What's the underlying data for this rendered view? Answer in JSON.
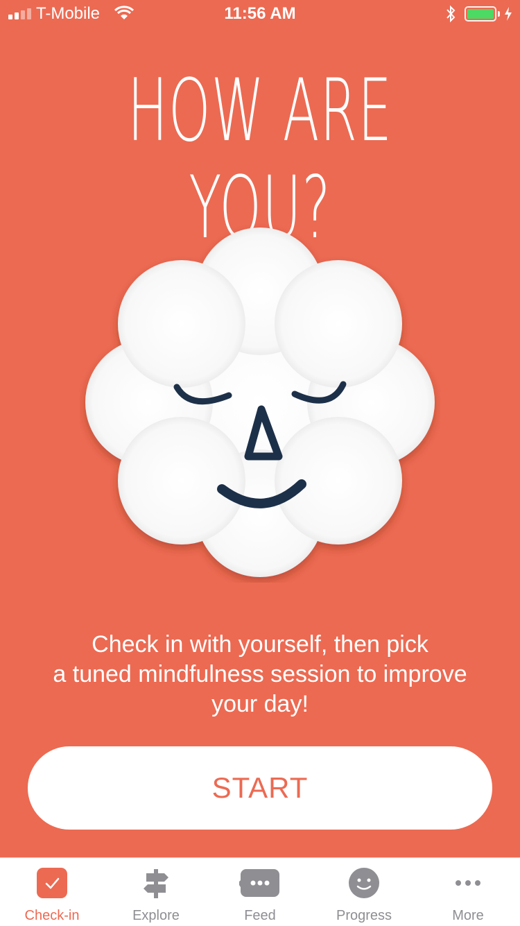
{
  "status_bar": {
    "carrier": "T-Mobile",
    "time": "11:56 AM",
    "battery_color": "#4CD964"
  },
  "main": {
    "title": "HOW ARE YOU?",
    "mascot_icon": "smiling-cloud-face",
    "description": "Check in with yourself, then pick\na tuned mindfulness session to improve\nyour day!",
    "start_label": "START"
  },
  "tab_bar": {
    "tabs": [
      {
        "label": "Check-in",
        "icon": "checkmark-icon",
        "active": true
      },
      {
        "label": "Explore",
        "icon": "signpost-icon",
        "active": false
      },
      {
        "label": "Feed",
        "icon": "chat-bubble-icon",
        "active": false
      },
      {
        "label": "Progress",
        "icon": "smiley-icon",
        "active": false
      },
      {
        "label": "More",
        "icon": "ellipsis-icon",
        "active": false
      }
    ]
  },
  "colors": {
    "background": "#EC6A52",
    "accent": "#EC6A52",
    "tab_inactive": "#8E8E93",
    "face_features": "#1D3049"
  }
}
